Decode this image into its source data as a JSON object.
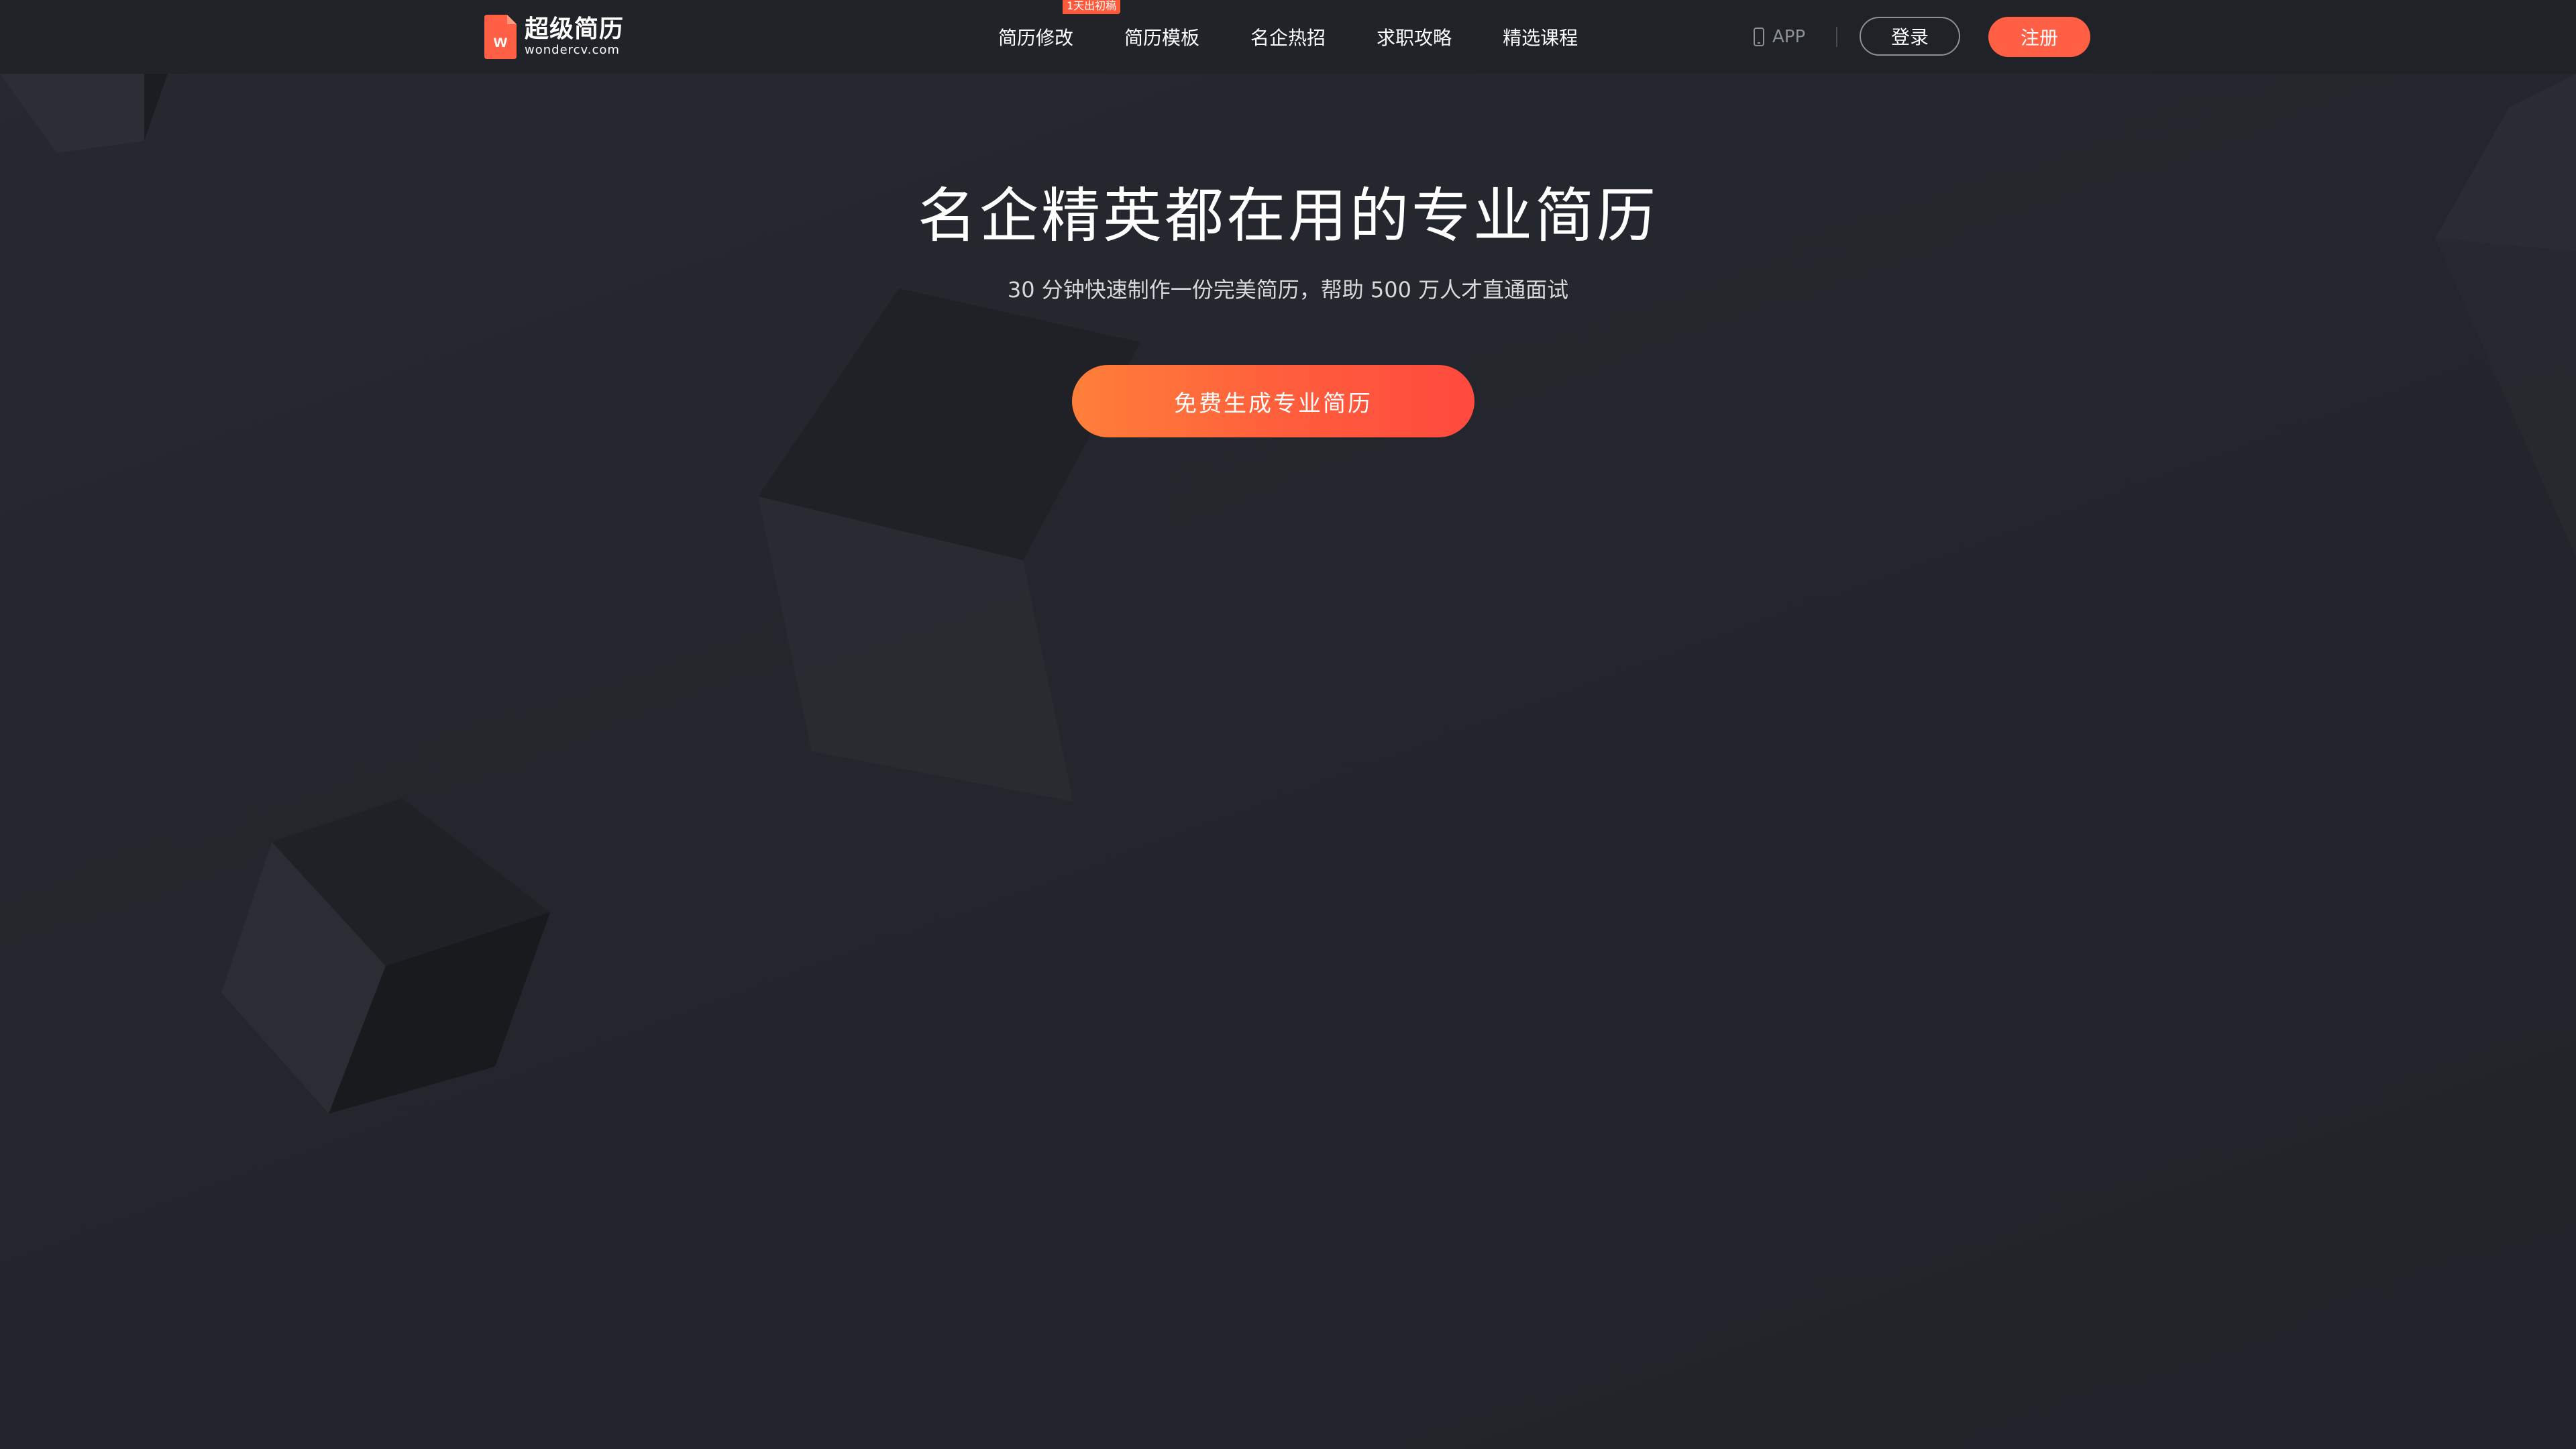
{
  "nav": {
    "logo": {
      "name_cn": "超级简历",
      "domain": "wondercv.com"
    },
    "menu": [
      {
        "label": "简历修改",
        "badge": "1天出初稿"
      },
      {
        "label": "简历模板"
      },
      {
        "label": "名企热招"
      },
      {
        "label": "求职攻略"
      },
      {
        "label": "精选课程"
      }
    ],
    "app_label": "APP",
    "login_label": "登录",
    "register_label": "注册"
  },
  "hero": {
    "title": "名企精英都在用的专业简历",
    "subtitle": "30 分钟快速制作一份完美简历，帮助 500 万人才直通面试",
    "cta_label": "免费生成专业简历"
  },
  "colors": {
    "background": "#22252b",
    "accent": "#ff5f45",
    "cta_gradient_start": "#ff7f3a",
    "cta_gradient_end": "#ff4a3f"
  },
  "icons": {
    "logo": "wondercv-logo-icon",
    "app": "phone-icon"
  }
}
